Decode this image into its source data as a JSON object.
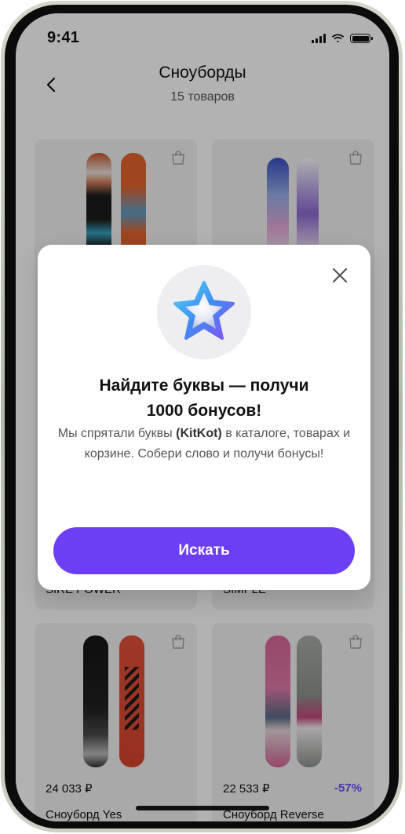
{
  "status_bar": {
    "time": "9:41",
    "icons": [
      "signal-icon",
      "wifi-icon",
      "battery-icon"
    ]
  },
  "header": {
    "title": "Сноуборды",
    "subtitle": "15 товаров",
    "back_icon": "chevron-left-icon"
  },
  "products": [
    {
      "name": "SIRE POWER",
      "price": "",
      "discount": ""
    },
    {
      "name": "SIMPLE",
      "price": "",
      "discount": ""
    },
    {
      "name": "Сноуборд Yes",
      "price": "24 033 ₽",
      "discount": ""
    },
    {
      "name": "Сноуборд Reverse",
      "price": "22 533 ₽",
      "discount": "-57%"
    }
  ],
  "modal": {
    "title_line1": "Найдите буквы — получи",
    "title_line2": "1000 бонусов!",
    "text_before": "Мы спрятали буквы ",
    "text_highlight": "(KitKot)",
    "text_after": " в каталоге, товарах и корзине. Собери слово и получи бонусы!",
    "button_label": "Искать",
    "icon": "star-icon",
    "close_icon": "close-icon"
  },
  "colors": {
    "accent": "#6c3ff5",
    "discount": "#6c4ff6",
    "overlay": "rgba(0,0,0,0.30)"
  }
}
